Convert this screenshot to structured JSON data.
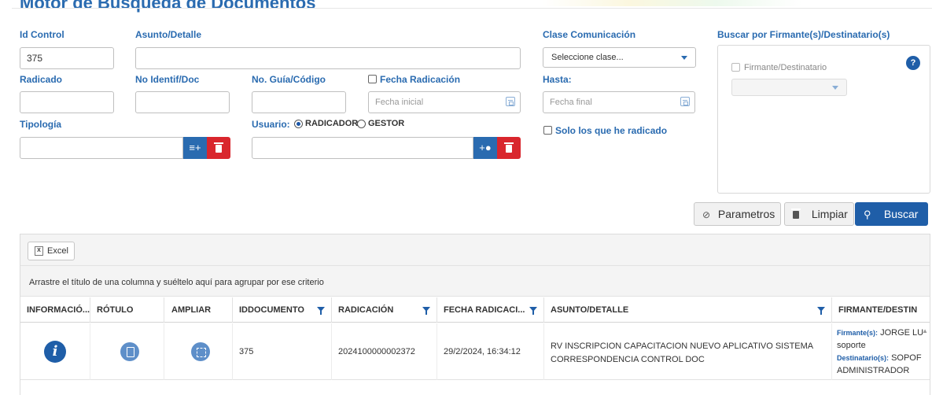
{
  "page": {
    "title": "Motor de Búsqueda de Documentos"
  },
  "form": {
    "id_control": {
      "label": "Id Control",
      "value": "375"
    },
    "asunto": {
      "label": "Asunto/Detalle",
      "value": ""
    },
    "radicado": {
      "label": "Radicado",
      "value": ""
    },
    "no_identif": {
      "label": "No Identif/Doc",
      "value": ""
    },
    "no_guia": {
      "label": "No. Guía/Código",
      "value": ""
    },
    "fecha_radicacion": {
      "label": "Fecha Radicación",
      "checked": false,
      "placeholder": "Fecha inicial"
    },
    "tipologia": {
      "label": "Tipología",
      "value": ""
    },
    "usuario": {
      "label": "Usuario:",
      "options": [
        "RADICADOR",
        "GESTOR"
      ],
      "selected": "RADICADOR",
      "value": ""
    },
    "clase": {
      "label": "Clase Comunicación",
      "selected": "Seleccione clase..."
    },
    "hasta": {
      "label": "Hasta:",
      "placeholder": "Fecha final"
    },
    "solo_radicado": {
      "label": "Solo los que he radicado",
      "checked": false
    }
  },
  "firmante_panel": {
    "title": "Buscar por Firmante(s)/Destinatario(s)",
    "checkbox_label": "Firmante/Destinatario",
    "help": "?"
  },
  "actions": {
    "parametros": "Parametros",
    "limpiar": "Limpiar",
    "buscar": "Buscar"
  },
  "grid": {
    "excel_label": "Excel",
    "group_hint": "Arrastre el título de una columna y suéltelo aquí para agrupar por ese criterio",
    "columns": [
      "INFORMACIÓ...",
      "RÓTULO",
      "AMPLIAR",
      "IDDOCUMENTO",
      "RADICACIÓN",
      "FECHA RADICACI...",
      "ASUNTO/DETALLE",
      "FIRMANTE/DESTIN"
    ],
    "rows": [
      {
        "iddocumento": "375",
        "radicacion": "2024100000002372",
        "fecha": "29/2/2024, 16:34:12",
        "asunto": "RV INSCRIPCION CAPACITACION NUEVO APLICATIVO SISTEMA CORRESPONDENCIA CONTROL DOC",
        "firmante_key": "Firmante(s):",
        "firmante_value": "JORGE LU",
        "firmante_value2": "soporte",
        "destinatario_key": "Destinatario(s):",
        "destinatario_value": "SOPOF",
        "destinatario_value2": "ADMINISTRADOR"
      }
    ]
  },
  "colors": {
    "primary": "#1f5ea8",
    "label": "#2a6bb0",
    "danger": "#d9262d"
  }
}
